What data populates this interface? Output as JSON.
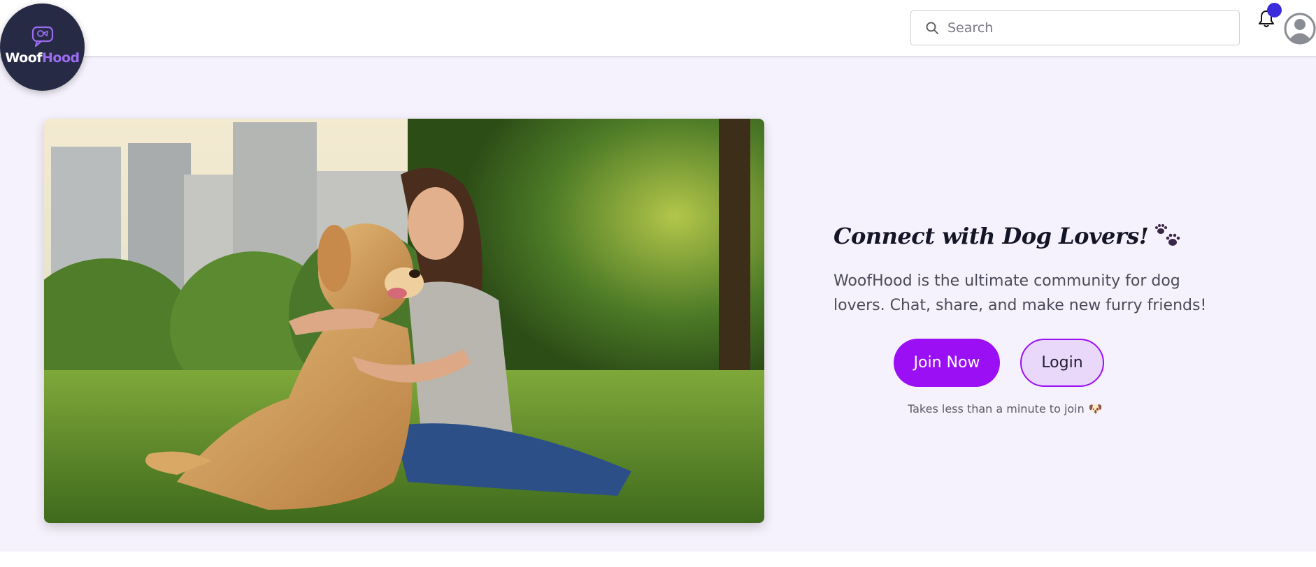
{
  "brand": {
    "name_part1": "Woof",
    "name_part2": "Hood",
    "icon": "chat-bubble-dog-icon"
  },
  "header": {
    "search_placeholder": "Search",
    "notification_icon": "bell-icon",
    "avatar_icon": "user-avatar-icon"
  },
  "hero": {
    "image_icon": "woman-hugging-golden-retriever-photo",
    "headline": "Connect with Dog Lovers!",
    "headline_icon": "paw-prints-icon",
    "description": "WoofHood is the ultimate community for dog lovers. Chat, share, and make new furry friends!",
    "join_label": "Join Now",
    "login_label": "Login",
    "hint": "Takes less than a minute to join",
    "hint_emoji": "🐶"
  },
  "colors": {
    "accent": "#9b0ff5",
    "login_bg": "#ead8fb",
    "page_bg": "#f6f2fd",
    "logo_bg": "#272a45",
    "notification_dot": "#3a2bdc"
  }
}
